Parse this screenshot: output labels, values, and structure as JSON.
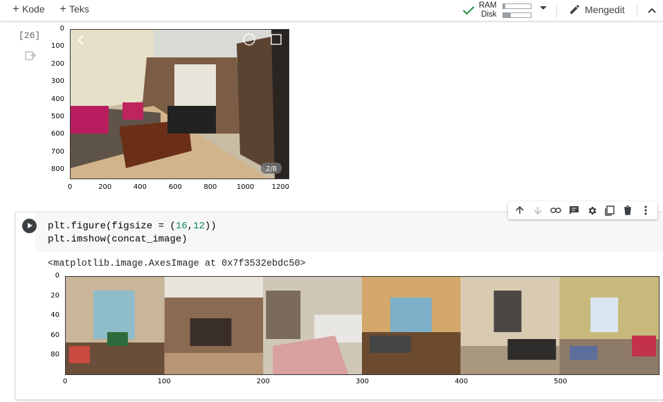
{
  "toolbar": {
    "add_code": "Kode",
    "add_text": "Teks",
    "ram_label": "RAM",
    "disk_label": "Disk",
    "ram_usage": 0.08,
    "disk_usage": 0.28,
    "edit_mode": "Mengedit"
  },
  "cell1": {
    "exec_count": "[26]",
    "image_caption": "2/8",
    "y_ticks": [
      "0",
      "100",
      "200",
      "300",
      "400",
      "500",
      "600",
      "700",
      "800"
    ],
    "x_ticks": [
      "0",
      "200",
      "400",
      "600",
      "800",
      "1000",
      "1200"
    ]
  },
  "cell2": {
    "code_line1_prefix": "plt.figure(figsize = (",
    "code_num1": "16",
    "code_comma": ",",
    "code_num2": "12",
    "code_line1_suffix": "))",
    "code_line2": "plt.imshow(concat_image)",
    "output": "<matplotlib.image.AxesImage at 0x7f3532ebdc50>",
    "y_ticks": [
      "0",
      "20",
      "40",
      "60",
      "80"
    ],
    "x_ticks": [
      "0",
      "100",
      "200",
      "300",
      "400",
      "500"
    ]
  },
  "cell_toolbar": {
    "icons": [
      "arrow-up-icon",
      "arrow-down-icon",
      "link-icon",
      "comment-icon",
      "gear-icon",
      "mirror-cell-icon",
      "trash-icon",
      "more-vert-icon"
    ]
  },
  "colors": {
    "accent_check": "#1e8e3e",
    "code_number": "#098658",
    "cell_bg": "#f7f7f7"
  }
}
